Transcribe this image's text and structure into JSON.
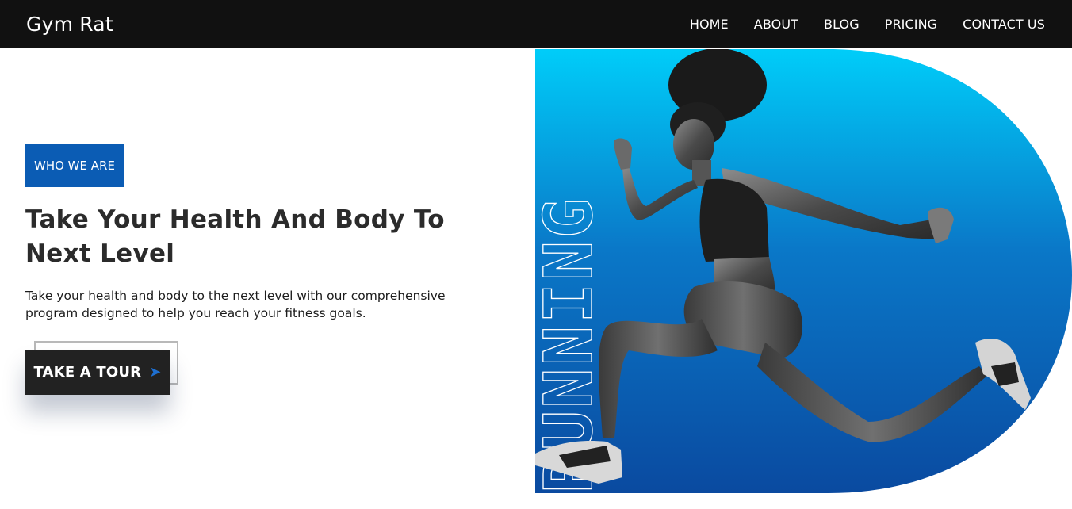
{
  "nav": {
    "brand": "Gym Rat",
    "links": [
      "HOME",
      "ABOUT",
      "BLOG",
      "PRICING",
      "CONTACT US"
    ]
  },
  "hero": {
    "badge": "WHO WE ARE",
    "headline": "Take Your Health And Body To Next Level",
    "subtext": "Take your health and body to the next level with our comprehensive program designed to help you reach your fitness goals.",
    "cta_label": "TAKE A TOUR",
    "cta_icon": "arrow-right-icon",
    "vertical_word": "RUNNING"
  },
  "colors": {
    "navbar_bg": "#111111",
    "accent_blue": "#0b5cb4",
    "gradient_top": "#00c8f8",
    "gradient_bottom": "#0a4aa0",
    "cta_bg": "#222222"
  }
}
